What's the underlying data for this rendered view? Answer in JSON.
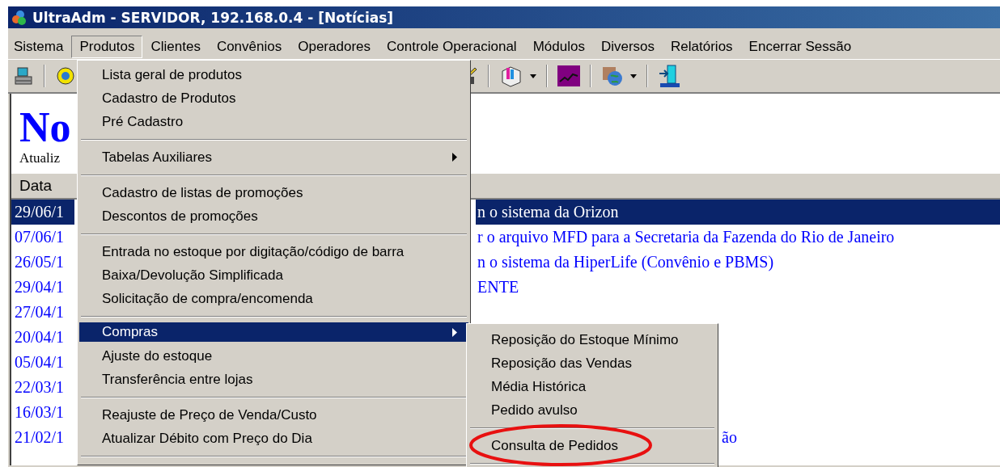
{
  "window": {
    "title": "UltraAdm - SERVIDOR, 192.168.0.4 - [Notícias]"
  },
  "menubar": [
    {
      "label": "Sistema",
      "selected": false
    },
    {
      "label": "Produtos",
      "selected": true
    },
    {
      "label": "Clientes",
      "selected": false
    },
    {
      "label": "Convênios",
      "selected": false
    },
    {
      "label": "Operadores",
      "selected": false
    },
    {
      "label": "Controle Operacional",
      "selected": false
    },
    {
      "label": "Módulos",
      "selected": false
    },
    {
      "label": "Diversos",
      "selected": false
    },
    {
      "label": "Relatórios",
      "selected": false
    },
    {
      "label": "Encerrar Sessão",
      "selected": false
    }
  ],
  "page": {
    "heading": "No",
    "subtitle": "Atualiz",
    "column_header": "Data",
    "rows": [
      {
        "date": "29/06/1",
        "text": "n o sistema da Orizon",
        "selected": true
      },
      {
        "date": "07/06/1",
        "text": "r o arquivo MFD para a Secretaria da Fazenda do Rio de Janeiro",
        "selected": false
      },
      {
        "date": "26/05/1",
        "text": "n o sistema da HiperLife (Convênio e PBMS)",
        "selected": false
      },
      {
        "date": "29/04/1",
        "text": "ENTE",
        "selected": false
      },
      {
        "date": "27/04/1",
        "selected": false
      },
      {
        "date": "20/04/1",
        "selected": false
      },
      {
        "date": "05/04/1",
        "selected": false
      },
      {
        "date": "22/03/1",
        "selected": false
      },
      {
        "date": "16/03/1",
        "selected": false
      },
      {
        "date": "21/02/1",
        "text": "ão",
        "selected": false
      }
    ]
  },
  "menu": {
    "items": [
      {
        "kind": "item",
        "label": "Lista geral de produtos",
        "submenu": false,
        "selected": false
      },
      {
        "kind": "item",
        "label": "Cadastro de Produtos",
        "submenu": false,
        "selected": false
      },
      {
        "kind": "item",
        "label": "Pré Cadastro",
        "submenu": false,
        "selected": false
      },
      {
        "kind": "separator"
      },
      {
        "kind": "item",
        "label": "Tabelas Auxiliares",
        "submenu": true,
        "selected": false
      },
      {
        "kind": "separator"
      },
      {
        "kind": "item",
        "label": "Cadastro de listas de promoções",
        "submenu": false,
        "selected": false
      },
      {
        "kind": "item",
        "label": "Descontos de promoções",
        "submenu": false,
        "selected": false
      },
      {
        "kind": "separator"
      },
      {
        "kind": "item",
        "label": "Entrada no estoque por digitação/código de barra",
        "submenu": false,
        "selected": false
      },
      {
        "kind": "item",
        "label": "Baixa/Devolução Simplificada",
        "submenu": false,
        "selected": false
      },
      {
        "kind": "item",
        "label": "Solicitação de compra/encomenda",
        "submenu": false,
        "selected": false
      },
      {
        "kind": "separator"
      },
      {
        "kind": "item",
        "label": "Compras",
        "submenu": true,
        "selected": true
      },
      {
        "kind": "item",
        "label": "Ajuste do estoque",
        "submenu": false,
        "selected": false
      },
      {
        "kind": "item",
        "label": "Transferência entre lojas",
        "submenu": false,
        "selected": false
      },
      {
        "kind": "separator"
      },
      {
        "kind": "item",
        "label": "Reajuste de Preço de Venda/Custo",
        "submenu": false,
        "selected": false
      },
      {
        "kind": "item",
        "label": "Atualizar Débito com Preço do Dia",
        "submenu": false,
        "selected": false
      },
      {
        "kind": "separator"
      }
    ]
  },
  "submenu": {
    "items": [
      {
        "kind": "item",
        "label": "Reposição do Estoque Mínimo",
        "circled": false
      },
      {
        "kind": "item",
        "label": "Reposição das Vendas",
        "circled": false
      },
      {
        "kind": "item",
        "label": "Média Histórica",
        "circled": false
      },
      {
        "kind": "item",
        "label": "Pedido avulso",
        "circled": false
      },
      {
        "kind": "separator"
      },
      {
        "kind": "item",
        "label": "Consulta de Pedidos",
        "circled": true
      },
      {
        "kind": "separator"
      }
    ]
  }
}
